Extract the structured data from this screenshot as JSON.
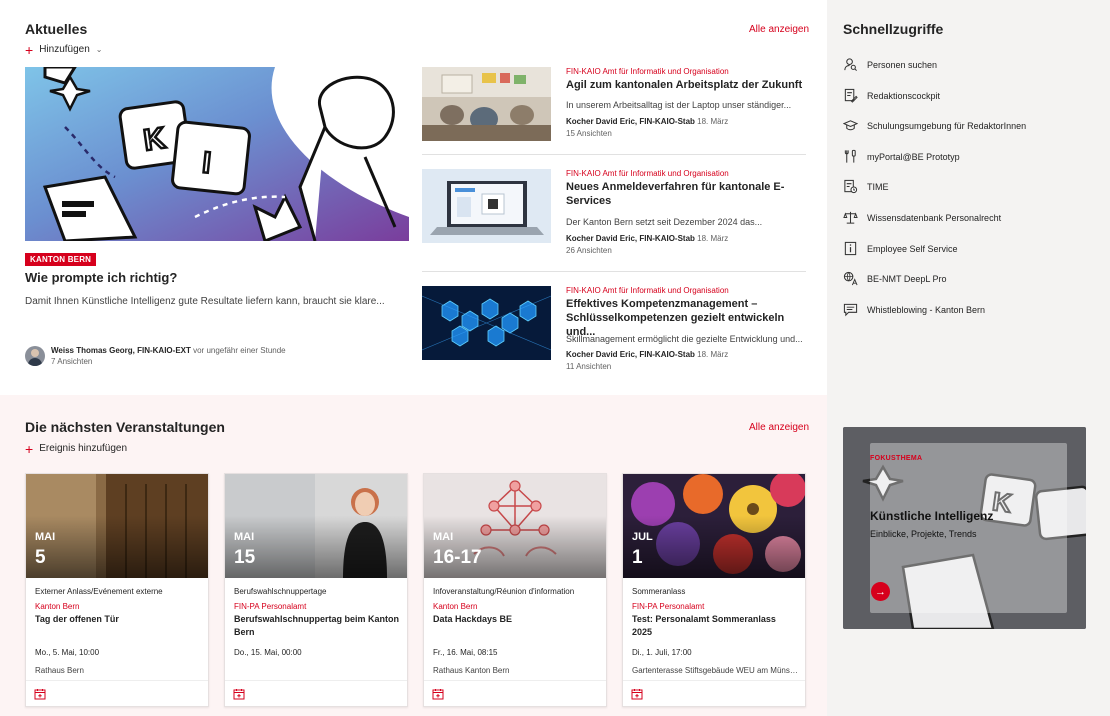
{
  "news": {
    "title": "Aktuelles",
    "see_all": "Alle anzeigen",
    "add_label": "Hinzufügen",
    "hero": {
      "badge": "KANTON BERN",
      "title": "Wie prompte ich richtig?",
      "description": "Damit Ihnen Künstliche Intelligenz gute Resultate liefern kann, braucht sie klare...",
      "author": "Weiss Thomas Georg, FIN-KAIO-EXT",
      "time": "vor ungefähr einer Stunde",
      "views": "7 Ansichten"
    },
    "items": [
      {
        "category": "FIN-KAIO Amt für Informatik und Organisation",
        "title": "Agil zum kantonalen Arbeitsplatz der Zukunft",
        "description": "In unserem Arbeitsalltag ist der Laptop unser ständiger...",
        "author": "Kocher David Eric, FIN-KAIO-Stab",
        "date": "18. März",
        "views": "15 Ansichten"
      },
      {
        "category": "FIN-KAIO Amt für Informatik und Organisation",
        "title": "Neues Anmeldeverfahren für kantonale E-Services",
        "description": "Der Kanton Bern setzt seit Dezember 2024 das...",
        "author": "Kocher David Eric, FIN-KAIO-Stab",
        "date": "18. März",
        "views": "26 Ansichten"
      },
      {
        "category": "FIN-KAIO Amt für Informatik und Organisation",
        "title": "Effektives Kompetenzmanagement – Schlüsselkompetenzen gezielt entwickeln und...",
        "description": "Skillmanagement ermöglicht die gezielte Entwicklung und...",
        "author": "Kocher David Eric, FIN-KAIO-Stab",
        "date": "18. März",
        "views": "11 Ansichten"
      }
    ]
  },
  "sidebar": {
    "title": "Schnellzugriffe",
    "links": [
      {
        "label": "Personen suchen",
        "icon": "person-search-icon"
      },
      {
        "label": "Redaktionscockpit",
        "icon": "edit-document-icon"
      },
      {
        "label": "Schulungsumgebung für RedaktorInnen",
        "icon": "graduation-cap-icon"
      },
      {
        "label": "myPortal@BE Prototyp",
        "icon": "tools-icon"
      },
      {
        "label": "TIME",
        "icon": "clock-document-icon"
      },
      {
        "label": "Wissensdatenbank Personalrecht",
        "icon": "scales-icon"
      },
      {
        "label": "Employee Self Service",
        "icon": "info-icon"
      },
      {
        "label": "BE-NMT DeepL Pro",
        "icon": "translate-icon"
      },
      {
        "label": "Whistleblowing - Kanton Bern",
        "icon": "chat-icon"
      }
    ],
    "focus": {
      "label": "FOKUSTHEMA",
      "title": "Künstliche Intelligenz",
      "subtitle": "Einblicke, Projekte, Trends"
    }
  },
  "events": {
    "title": "Die nächsten Veranstaltungen",
    "see_all": "Alle anzeigen",
    "add_label": "Ereignis hinzufügen",
    "items": [
      {
        "month": "MAI",
        "day": "5",
        "type": "Externer Anlass/Evénement externe",
        "org": "Kanton Bern",
        "title": "Tag der offenen Tür",
        "when": "Mo., 5. Mai, 10:00",
        "where": "Rathaus Bern"
      },
      {
        "month": "MAI",
        "day": "15",
        "type": "Berufswahlschnuppertage",
        "org": "FIN-PA Personalamt",
        "title": "Berufswahlschnuppertag beim Kanton Bern",
        "when": "Do., 15. Mai, 00:00",
        "where": ""
      },
      {
        "month": "MAI",
        "day": "16-17",
        "type": "Infoveranstaltung/Réunion d'information",
        "org": "Kanton Bern",
        "title": "Data Hackdays BE",
        "when": "Fr., 16. Mai, 08:15",
        "where": "Rathaus Kanton Bern"
      },
      {
        "month": "JUL",
        "day": "1",
        "type": "Sommeranlass",
        "org": "FIN-PA Personalamt",
        "title": "Test: Personalamt Sommeranlass 2025",
        "when": "Di., 1. Juli, 17:00",
        "where": "Gartenterasse Stiftsgebäude WEU am Münst..."
      }
    ]
  },
  "colors": {
    "accent": "#d6001c",
    "sidebar_bg": "#f4f3f2",
    "events_bg": "#fdf4f4"
  }
}
